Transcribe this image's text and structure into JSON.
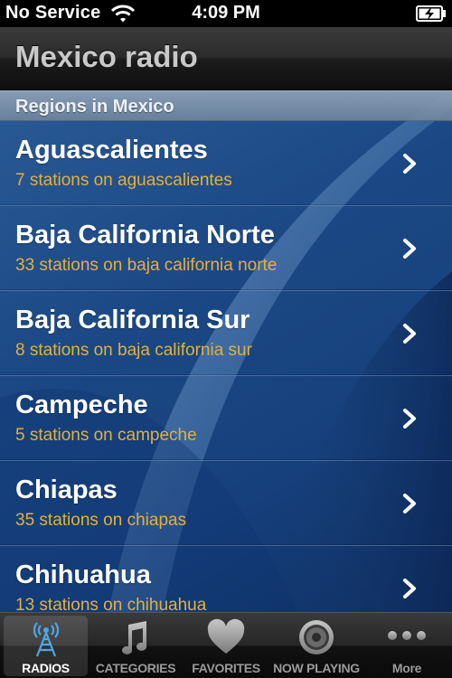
{
  "status_bar": {
    "carrier": "No Service",
    "time": "4:09 PM"
  },
  "nav": {
    "title": "Mexico radio"
  },
  "section": {
    "header": "Regions in Mexico"
  },
  "regions": [
    {
      "name": "Aguascalientes",
      "subtitle": "7 stations on aguascalientes"
    },
    {
      "name": "Baja California Norte",
      "subtitle": "33 stations on baja california norte"
    },
    {
      "name": "Baja California Sur",
      "subtitle": "8 stations on baja california sur"
    },
    {
      "name": "Campeche",
      "subtitle": "5 stations on campeche"
    },
    {
      "name": "Chiapas",
      "subtitle": "35 stations on chiapas"
    },
    {
      "name": "Chihuahua",
      "subtitle": "13 stations on chihuahua"
    }
  ],
  "tabs": [
    {
      "label": "RADIOS",
      "icon": "radio-tower-icon",
      "active": true
    },
    {
      "label": "CATEGORIES",
      "icon": "music-note-icon",
      "active": false
    },
    {
      "label": "FAVORITES",
      "icon": "heart-icon",
      "active": false
    },
    {
      "label": "NOW PLAYING",
      "icon": "speaker-icon",
      "active": false
    },
    {
      "label": "More",
      "icon": "more-dots-icon",
      "active": false
    }
  ],
  "colors": {
    "subtitle": "#e3b03c",
    "list_background": "#1b4884",
    "active_tab_icon": "#4aa8e8"
  }
}
